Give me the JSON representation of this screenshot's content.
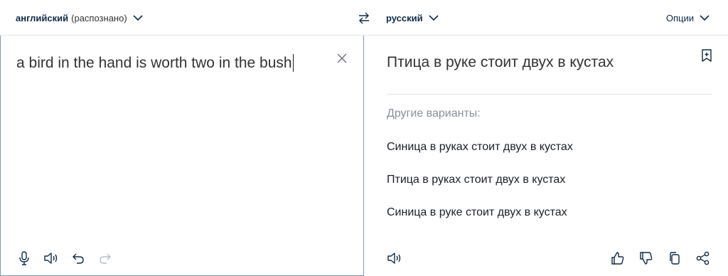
{
  "source_lang": {
    "name": "английский",
    "detected": "(распознано)"
  },
  "target_lang": {
    "name": "русский"
  },
  "options_label": "Опции",
  "source_text": "a bird in the hand is worth two in the bush",
  "translation": "Птица в руке стоит двух в кустах",
  "alternatives_heading": "Другие варианты:",
  "alternatives": [
    "Синица в руках стоит двух в кустах",
    "Птица в руках стоит двух в кустах",
    "Синица в руке стоит двух в кустах"
  ],
  "icons": {
    "source_toolbar": [
      "microphone-icon",
      "speaker-icon",
      "undo-icon",
      "redo-icon"
    ],
    "target_toolbar": [
      "speaker-icon",
      "thumbs-up-icon",
      "thumbs-down-icon",
      "copy-icon",
      "share-icon"
    ]
  },
  "colors": {
    "accent": "#0f2b46",
    "panel_border": "#7a9bb5",
    "muted": "#8a8f98"
  }
}
